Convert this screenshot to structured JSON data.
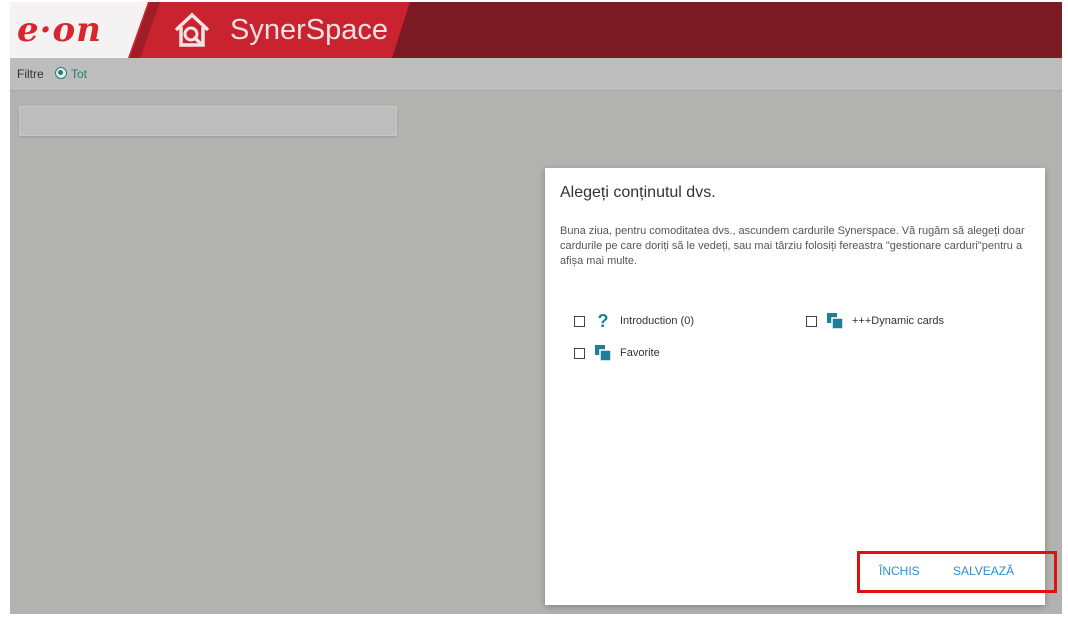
{
  "header": {
    "logo_text": "e·on",
    "app_title": "SynerSpace"
  },
  "filter": {
    "label": "Filtre",
    "selected_option": "Tot"
  },
  "dialog": {
    "title": "Alegeți conținutul dvs.",
    "message": "Buna ziua, pentru comoditatea dvs., ascundem cardurile Synerspace. Vă rugăm să alegeți doar cardurile pe care doriți să le vedeți, sau mai târziu folosiți fereastra \"gestionare carduri\"pentru a afișa mai multe.",
    "options": [
      {
        "label": "Introduction (0)",
        "icon": "question-icon",
        "checked": false
      },
      {
        "label": "+++Dynamic cards",
        "icon": "cards-icon",
        "checked": false
      },
      {
        "label": "Favorite",
        "icon": "cards-icon",
        "checked": false
      }
    ],
    "close_label": "ÎNCHIS",
    "save_label": "SALVEAZĂ"
  },
  "colors": {
    "header_dark": "#7a1a22",
    "header_red": "#c8232f",
    "accent_teal": "#1e7f7a",
    "button_blue": "#2b8fd0",
    "highlight_red": "#e0100f"
  }
}
